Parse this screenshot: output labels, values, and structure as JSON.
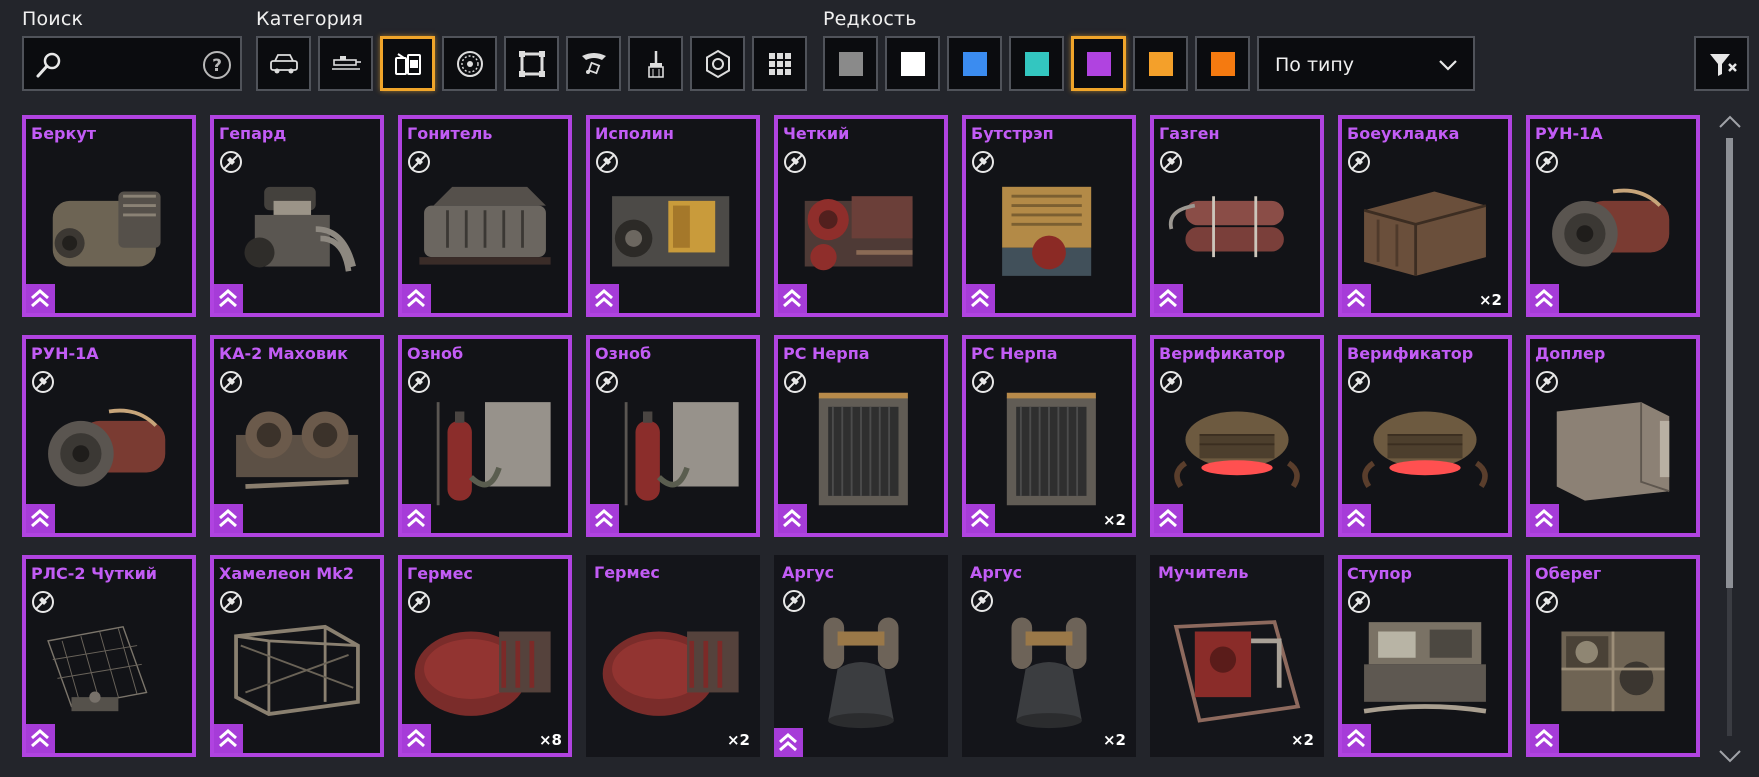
{
  "labels": {
    "search": "Поиск",
    "category": "Категория",
    "rarity": "Редкость"
  },
  "search": {
    "placeholder": "",
    "value": ""
  },
  "categories": [
    {
      "icon": "car-icon",
      "selected": false
    },
    {
      "icon": "weapon-icon",
      "selected": false
    },
    {
      "icon": "engine-cabin-icon",
      "selected": true
    },
    {
      "icon": "wheel-icon",
      "selected": false
    },
    {
      "icon": "frame-icon",
      "selected": false
    },
    {
      "icon": "decor-icon",
      "selected": false
    },
    {
      "icon": "paint-brush-icon",
      "selected": false
    },
    {
      "icon": "resource-icon",
      "selected": false
    },
    {
      "icon": "all-grid-icon",
      "selected": false
    }
  ],
  "rarities": [
    {
      "name": "common",
      "color": "#8a8a8a",
      "selected": false
    },
    {
      "name": "uncommon",
      "color": "#ffffff",
      "selected": false
    },
    {
      "name": "rare",
      "color": "#3b8cf0",
      "selected": false
    },
    {
      "name": "special",
      "color": "#33c6c0",
      "selected": false
    },
    {
      "name": "epic",
      "color": "#b043e0",
      "selected": true
    },
    {
      "name": "legendary",
      "color": "#f4a02a",
      "selected": false
    },
    {
      "name": "relic",
      "color": "#f57a10",
      "selected": false
    }
  ],
  "sort": {
    "value": "По типу"
  },
  "colors": {
    "epic_border": "#b043e0",
    "epic_text": "#c25cf5",
    "selected_outline": "#f0a52a",
    "background": "#23252b"
  },
  "items": [
    {
      "name": "Беркут",
      "art": "engine-block",
      "nosell": false,
      "rank": true,
      "qty": "",
      "border": true
    },
    {
      "name": "Гепард",
      "art": "engine-v8",
      "nosell": true,
      "rank": true,
      "qty": "",
      "border": true
    },
    {
      "name": "Гонитель",
      "art": "engine-long",
      "nosell": true,
      "rank": true,
      "qty": "",
      "border": true
    },
    {
      "name": "Исполин",
      "art": "engine-yellow",
      "nosell": true,
      "rank": true,
      "qty": "",
      "border": true
    },
    {
      "name": "Четкий",
      "art": "engine-red",
      "nosell": true,
      "rank": true,
      "qty": "",
      "border": true
    },
    {
      "name": "Бутстрэп",
      "art": "generator",
      "nosell": true,
      "rank": true,
      "qty": "",
      "border": true
    },
    {
      "name": "Газген",
      "art": "gas-tanks",
      "nosell": true,
      "rank": true,
      "qty": "",
      "border": true
    },
    {
      "name": "Боеукладка",
      "art": "ammo-crate",
      "nosell": true,
      "rank": true,
      "qty": "×2",
      "border": true
    },
    {
      "name": "РУН-1А",
      "art": "turbine",
      "nosell": true,
      "rank": true,
      "qty": "",
      "border": true
    },
    {
      "name": "РУН-1А",
      "art": "turbine",
      "nosell": true,
      "rank": true,
      "qty": "",
      "border": true
    },
    {
      "name": "КА-2 Маховик",
      "art": "flywheel",
      "nosell": true,
      "rank": true,
      "qty": "",
      "border": true
    },
    {
      "name": "Озноб",
      "art": "cooler",
      "nosell": true,
      "rank": true,
      "qty": "",
      "border": true
    },
    {
      "name": "Озноб",
      "art": "cooler",
      "nosell": true,
      "rank": true,
      "qty": "",
      "border": true
    },
    {
      "name": "РС Нерпа",
      "art": "radiator",
      "nosell": true,
      "rank": true,
      "qty": "",
      "border": true
    },
    {
      "name": "РС Нерпа",
      "art": "radiator",
      "nosell": true,
      "rank": true,
      "qty": "×2",
      "border": true
    },
    {
      "name": "Верификатор",
      "art": "scanner",
      "nosell": true,
      "rank": true,
      "qty": "",
      "border": true
    },
    {
      "name": "Верификатор",
      "art": "scanner",
      "nosell": true,
      "rank": true,
      "qty": "",
      "border": true
    },
    {
      "name": "Доплер",
      "art": "panel",
      "nosell": true,
      "rank": true,
      "qty": "",
      "border": true
    },
    {
      "name": "РЛС-2 Чуткий",
      "art": "radar",
      "nosell": true,
      "rank": true,
      "qty": "",
      "border": true
    },
    {
      "name": "Хамелеон Mk2",
      "art": "cage",
      "nosell": true,
      "rank": true,
      "qty": "",
      "border": true
    },
    {
      "name": "Гермес",
      "art": "red-tank",
      "nosell": true,
      "rank": true,
      "qty": "×8",
      "border": true
    },
    {
      "name": "Гермес",
      "art": "red-tank",
      "nosell": false,
      "rank": false,
      "qty": "×2",
      "border": false
    },
    {
      "name": "Аргус",
      "art": "pods",
      "nosell": true,
      "rank": true,
      "qty": "",
      "border": false
    },
    {
      "name": "Аргус",
      "art": "pods",
      "nosell": true,
      "rank": false,
      "qty": "×2",
      "border": false
    },
    {
      "name": "Мучитель",
      "art": "frame-red",
      "nosell": false,
      "rank": false,
      "qty": "×2",
      "border": false
    },
    {
      "name": "Ступор",
      "art": "machine",
      "nosell": true,
      "rank": true,
      "qty": "",
      "border": true
    },
    {
      "name": "Оберег",
      "art": "cube-machine",
      "nosell": true,
      "rank": true,
      "qty": "",
      "border": true
    }
  ]
}
